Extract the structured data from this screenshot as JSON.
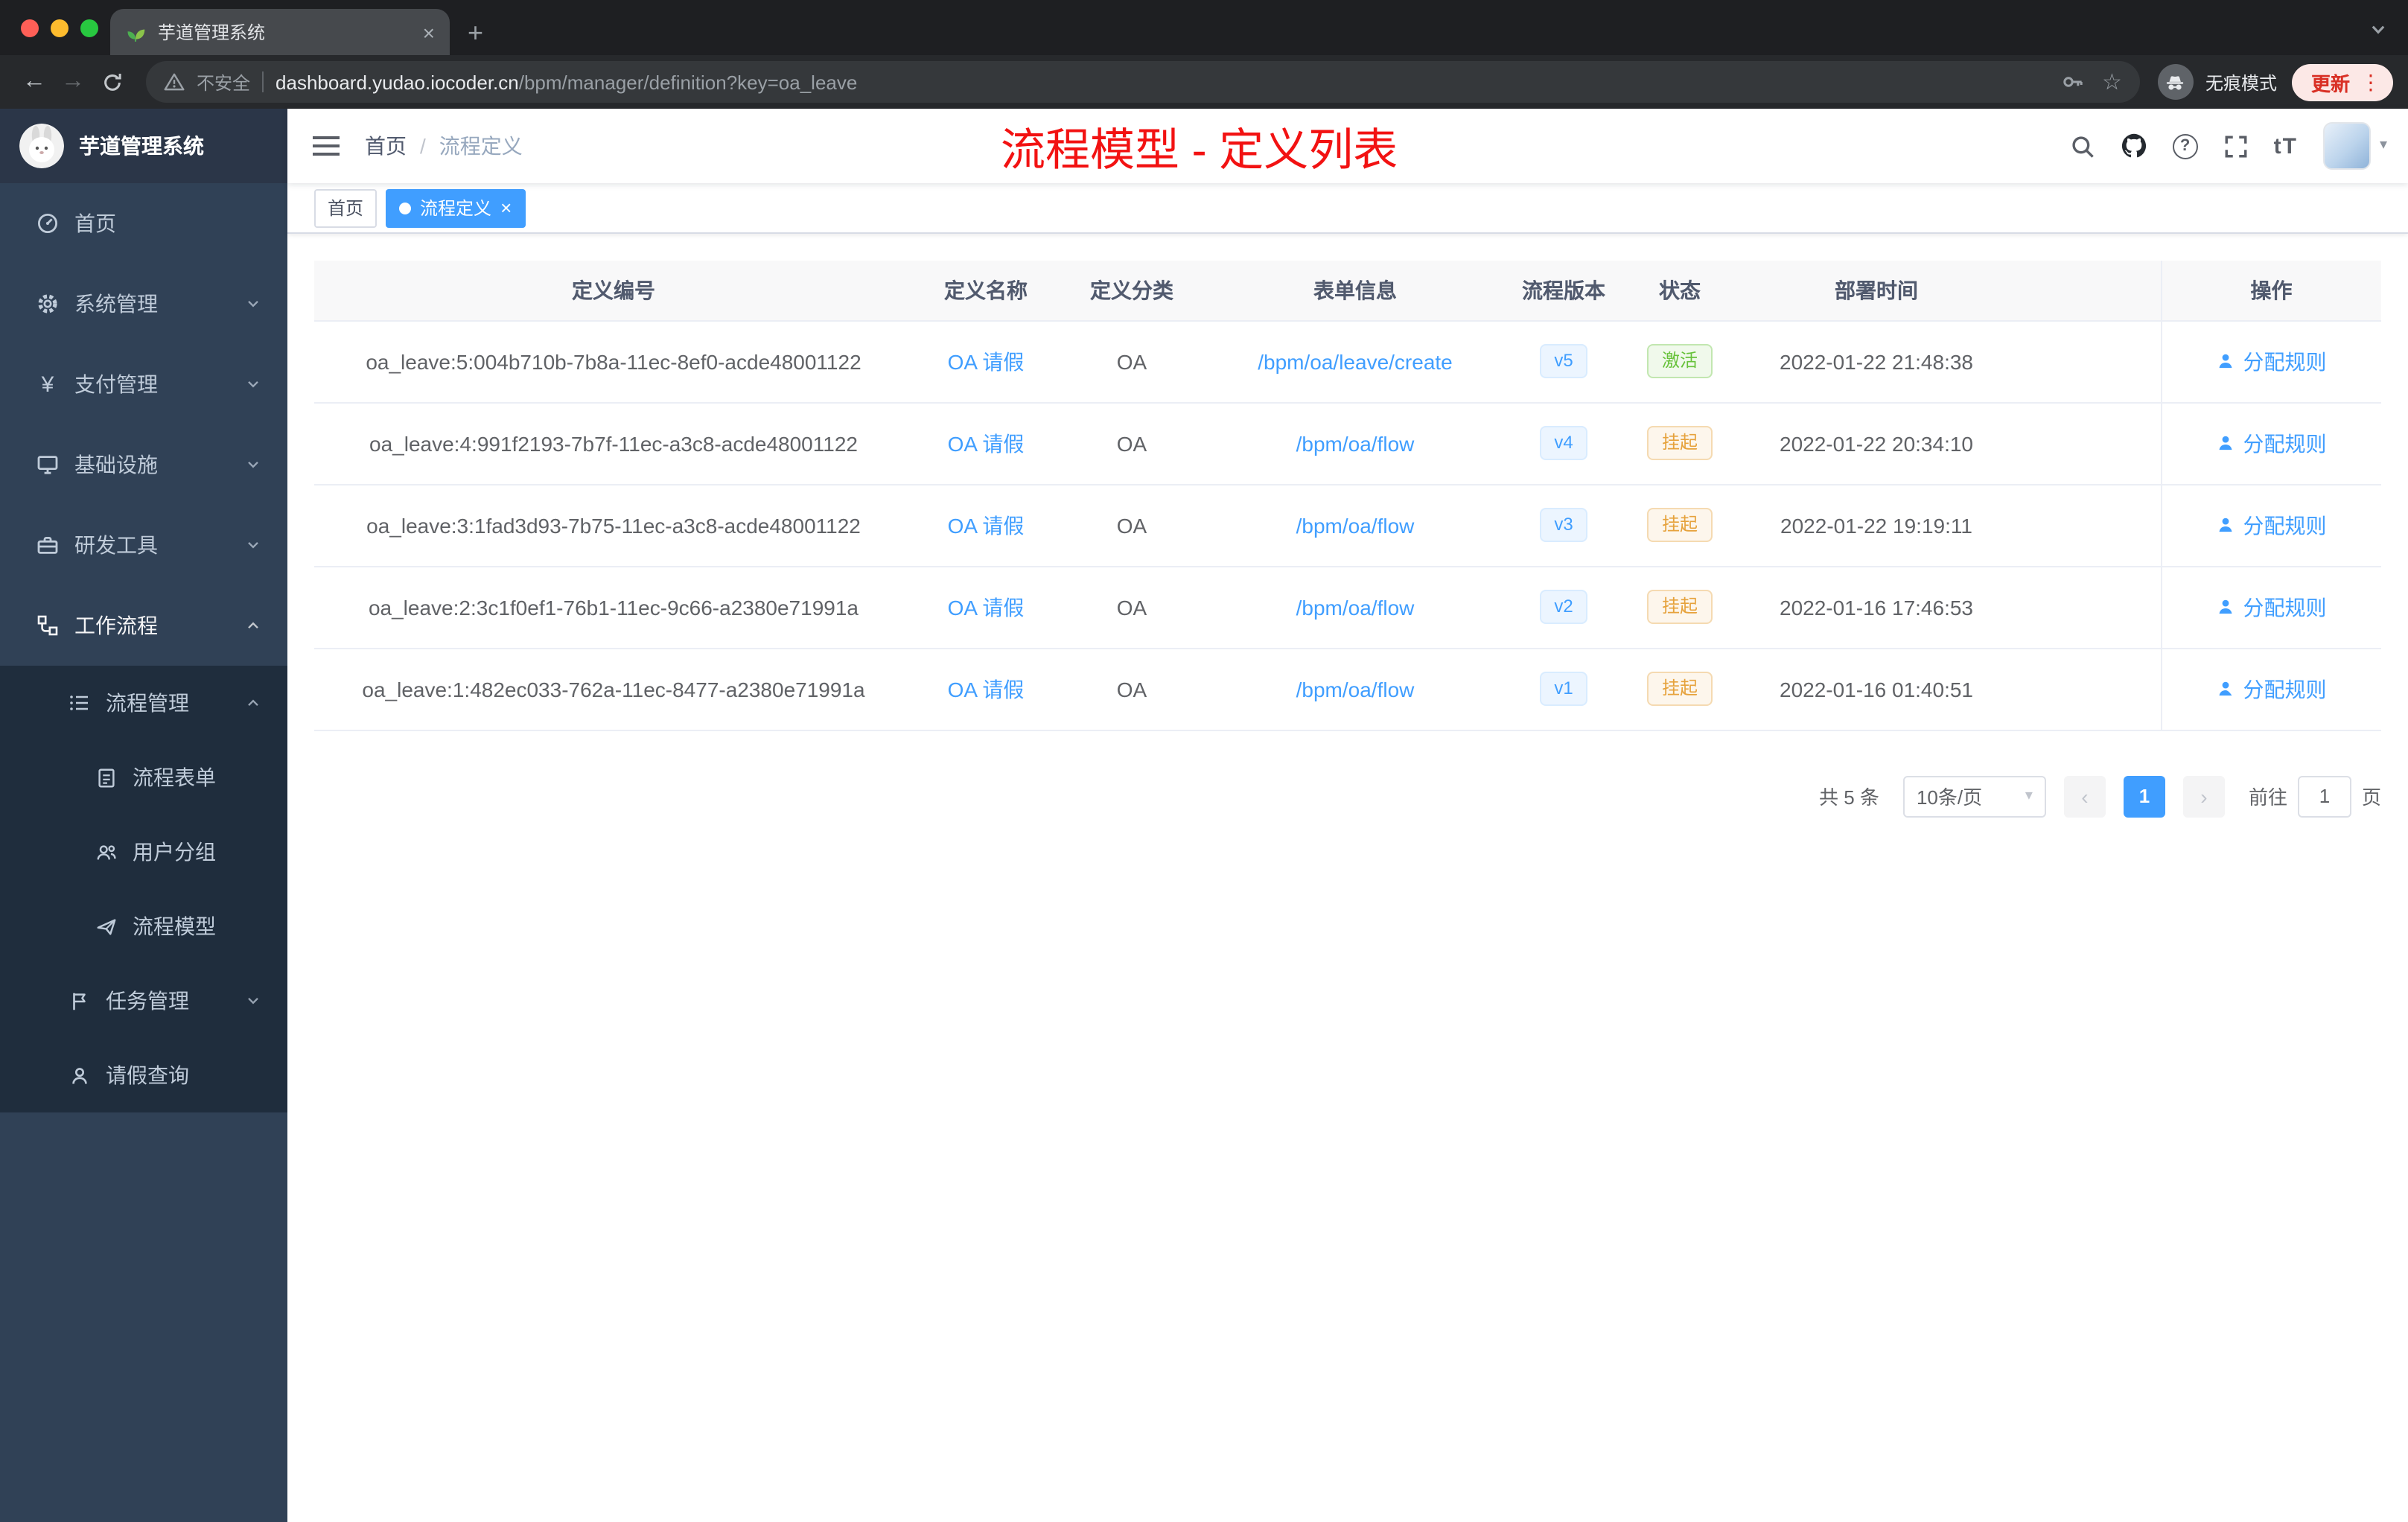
{
  "colors": {
    "accent": "#409EFF",
    "success": "#67C23A",
    "warning": "#E6A23C",
    "annotation_red": "#F21212",
    "sidebar_bg": "#304156",
    "submenu_bg": "#1F2D3D"
  },
  "icons": {
    "close": "×",
    "plus": "+",
    "back": "←",
    "forward": "→",
    "more": "⋮",
    "star": "☆",
    "caret": "▾",
    "yen": "¥",
    "prev": "‹",
    "next": "›",
    "question": "?"
  },
  "browser": {
    "tab_title": "芋道管理系统",
    "security_label": "不安全",
    "url_domain": "dashboard.yudao.iocoder.cn",
    "url_path": "/bpm/manager/definition?key=oa_leave",
    "incognito_label": "无痕模式",
    "update_label": "更新"
  },
  "sidebar": {
    "logo_title": "芋道管理系统",
    "items": [
      {
        "label": "首页",
        "icon": "dashboard-icon"
      },
      {
        "label": "系统管理",
        "icon": "gear-icon"
      },
      {
        "label": "支付管理",
        "icon": "yen-icon"
      },
      {
        "label": "基础设施",
        "icon": "infrastructure-icon"
      },
      {
        "label": "研发工具",
        "icon": "devtools-icon"
      },
      {
        "label": "工作流程",
        "icon": "workflow-icon"
      }
    ],
    "submenu": {
      "parent": {
        "label": "流程管理",
        "icon": "process-list-icon"
      },
      "children": [
        {
          "label": "流程表单",
          "icon": "form-icon"
        },
        {
          "label": "用户分组",
          "icon": "user-group-icon"
        },
        {
          "label": "流程模型",
          "icon": "paper-plane-icon"
        }
      ],
      "task": {
        "label": "任务管理",
        "icon": "task-icon"
      },
      "leave": {
        "label": "请假查询",
        "icon": "person-icon"
      }
    }
  },
  "navbar": {
    "breadcrumb_home": "首页",
    "breadcrumb_separator": "/",
    "breadcrumb_current": "流程定义",
    "annotation": "流程模型 - 定义列表",
    "font_size_icon": "tT"
  },
  "tags": {
    "home": "首页",
    "active": "流程定义"
  },
  "table": {
    "headers": [
      "定义编号",
      "定义名称",
      "定义分类",
      "表单信息",
      "流程版本",
      "状态",
      "部署时间",
      "操作"
    ],
    "rows": [
      {
        "id": "oa_leave:5:004b710b-7b8a-11ec-8ef0-acde48001122",
        "name": "OA 请假",
        "category": "OA",
        "form": "/bpm/oa/leave/create",
        "version": "v5",
        "status": "激活",
        "status_type": "success",
        "deploy_time": "2022-01-22 21:48:38",
        "action": "分配规则"
      },
      {
        "id": "oa_leave:4:991f2193-7b7f-11ec-a3c8-acde48001122",
        "name": "OA 请假",
        "category": "OA",
        "form": "/bpm/oa/flow",
        "version": "v4",
        "status": "挂起",
        "status_type": "warning",
        "deploy_time": "2022-01-22 20:34:10",
        "action": "分配规则"
      },
      {
        "id": "oa_leave:3:1fad3d93-7b75-11ec-a3c8-acde48001122",
        "name": "OA 请假",
        "category": "OA",
        "form": "/bpm/oa/flow",
        "version": "v3",
        "status": "挂起",
        "status_type": "warning",
        "deploy_time": "2022-01-22 19:19:11",
        "action": "分配规则"
      },
      {
        "id": "oa_leave:2:3c1f0ef1-76b1-11ec-9c66-a2380e71991a",
        "name": "OA 请假",
        "category": "OA",
        "form": "/bpm/oa/flow",
        "version": "v2",
        "status": "挂起",
        "status_type": "warning",
        "deploy_time": "2022-01-16 17:46:53",
        "action": "分配规则"
      },
      {
        "id": "oa_leave:1:482ec033-762a-11ec-8477-a2380e71991a",
        "name": "OA 请假",
        "category": "OA",
        "form": "/bpm/oa/flow",
        "version": "v1",
        "status": "挂起",
        "status_type": "warning",
        "deploy_time": "2022-01-16 01:40:51",
        "action": "分配规则"
      }
    ]
  },
  "pagination": {
    "total": "共 5 条",
    "page_size": "10条/页",
    "current_page": "1",
    "goto_label": "前往",
    "goto_value": "1",
    "goto_suffix": "页"
  }
}
